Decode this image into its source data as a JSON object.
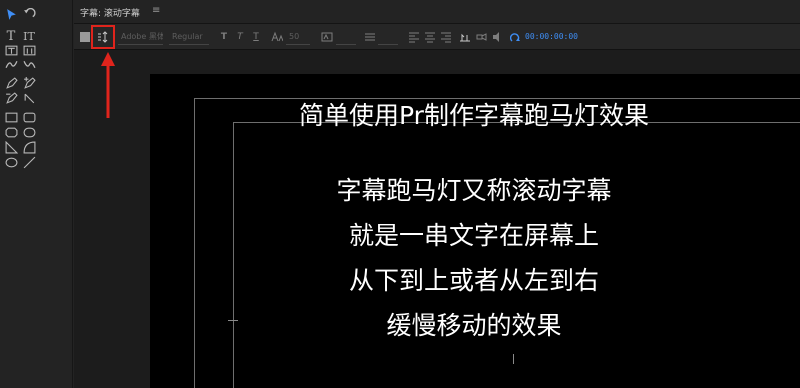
{
  "panel": {
    "tab_title": "字幕: 滚动字幕",
    "tab_menu_icon": "≡"
  },
  "tools": [
    {
      "name": "selection-tool-icon",
      "glyph": "▶",
      "selected": true
    },
    {
      "name": "rotation-tool-icon",
      "glyph": "↶"
    },
    {
      "name": "type-tool-icon",
      "glyph": "T"
    },
    {
      "name": "vertical-type-tool-icon",
      "glyph": "IT"
    },
    {
      "name": "area-type-tool-icon",
      "glyph": "▭"
    },
    {
      "name": "vertical-area-type-tool-icon",
      "glyph": "▭"
    },
    {
      "name": "path-type-tool-icon",
      "glyph": "〜"
    },
    {
      "name": "vertical-path-type-tool-icon",
      "glyph": "〜"
    },
    {
      "name": "pen-tool-icon",
      "glyph": "✒"
    },
    {
      "name": "add-anchor-tool-icon",
      "glyph": "✒"
    },
    {
      "name": "delete-anchor-tool-icon",
      "glyph": "✒"
    },
    {
      "name": "convert-anchor-tool-icon",
      "glyph": "◣"
    },
    {
      "name": "rectangle-tool-icon",
      "glyph": "▢"
    },
    {
      "name": "rounded-rectangle-tool-icon",
      "glyph": "▢"
    },
    {
      "name": "clipped-rectangle-tool-icon",
      "glyph": "▢"
    },
    {
      "name": "rounded-corner-rectangle-tool-icon",
      "glyph": "▢"
    },
    {
      "name": "wedge-tool-icon",
      "glyph": "◺"
    },
    {
      "name": "arc-tool-icon",
      "glyph": "◜"
    },
    {
      "name": "ellipse-tool-icon",
      "glyph": "○"
    },
    {
      "name": "line-tool-icon",
      "glyph": "╱"
    }
  ],
  "toolbar": {
    "font_family": "Adobe 黑体 Std",
    "font_style": "Regular",
    "bold_label": "T",
    "italic_label": "T",
    "underline_label": "T",
    "size_label": "50",
    "timecode": "00:00:00:00"
  },
  "caption": {
    "lines": [
      "简单使用Pr制作字幕跑马灯效果",
      "",
      "字幕跑马灯又称滚动字幕",
      "就是一串文字在屏幕上",
      "从下到上或者从左到右",
      "缓慢移动的效果"
    ]
  },
  "colors": {
    "accent": "#3f8ef5",
    "annotation": "#e0241c",
    "video_bg": "#000000",
    "text": "#ffffff"
  }
}
